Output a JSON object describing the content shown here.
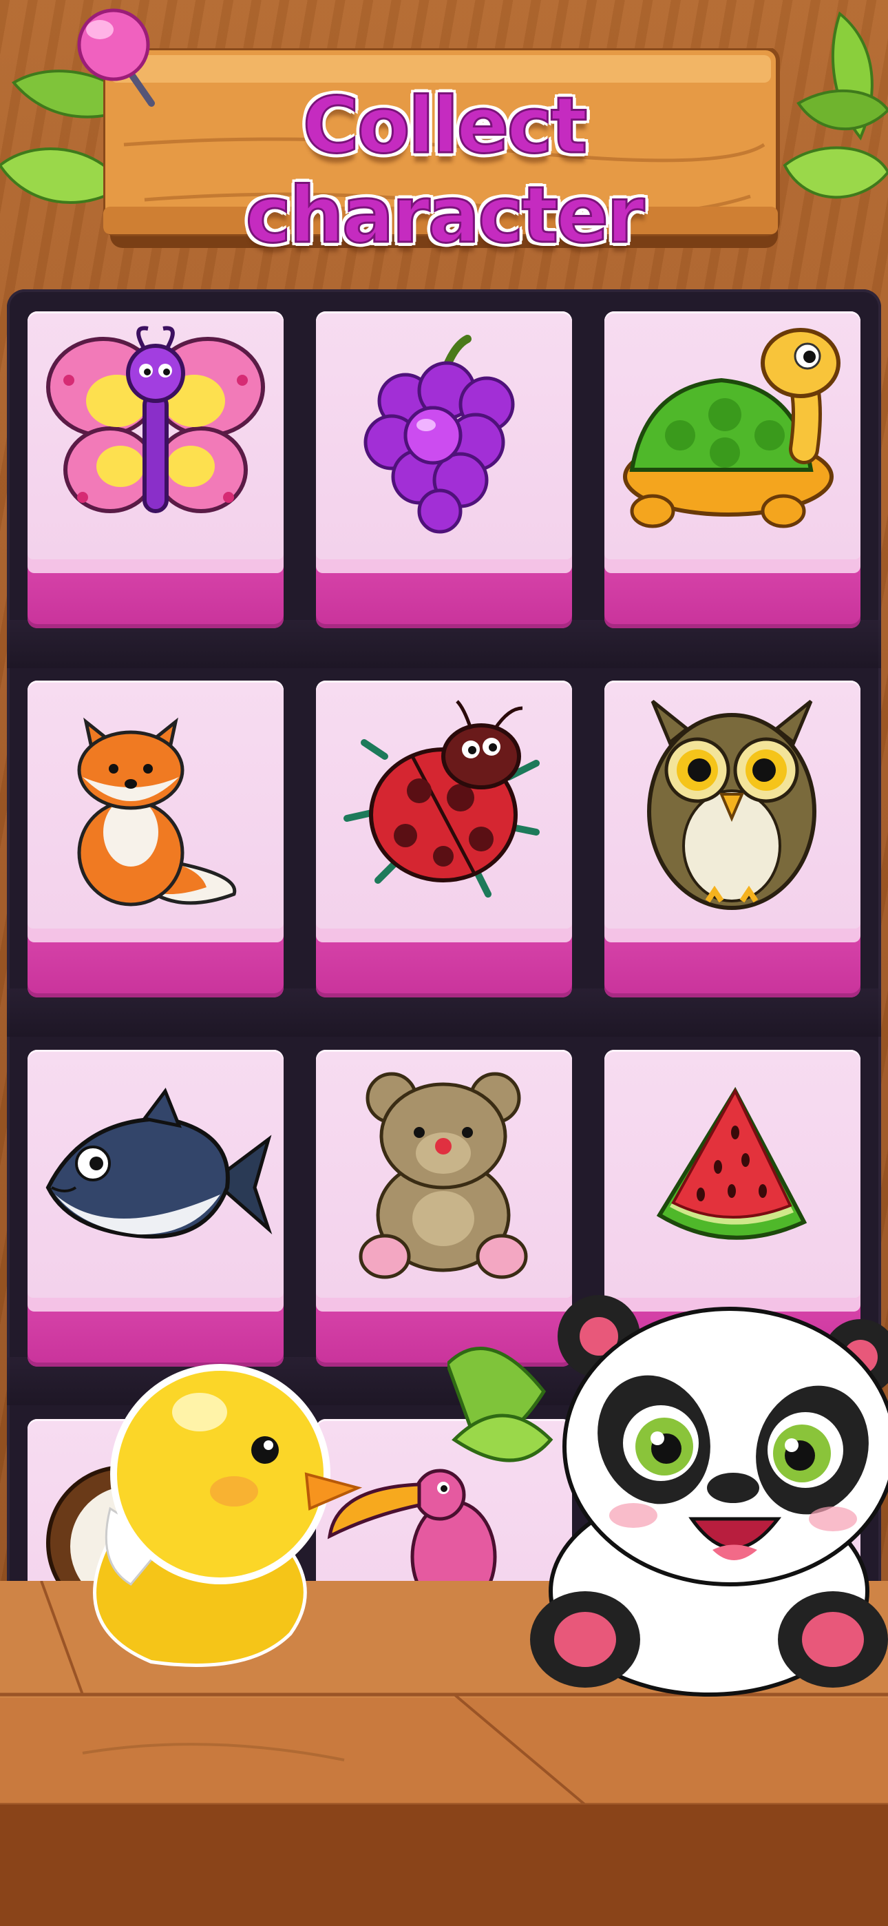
{
  "header": {
    "title": "Collect character"
  },
  "grid": {
    "tiles": [
      {
        "icon": "butterfly-icon"
      },
      {
        "icon": "grapes-icon"
      },
      {
        "icon": "turtle-icon"
      },
      {
        "icon": "fox-icon"
      },
      {
        "icon": "ladybug-icon"
      },
      {
        "icon": "owl-icon"
      },
      {
        "icon": "fish-icon"
      },
      {
        "icon": "teddy-bear-icon"
      },
      {
        "icon": "watermelon-icon"
      },
      {
        "icon": "coconut-icon"
      },
      {
        "icon": "toucan-icon"
      }
    ]
  },
  "mascots": [
    "duck-mascot",
    "panda-mascot"
  ],
  "colors": {
    "title": "#c52bc0",
    "tile_face": "#f5d6ee",
    "tile_base": "#d93fa9",
    "board": "#221a2b",
    "wood": "#a35a26"
  }
}
